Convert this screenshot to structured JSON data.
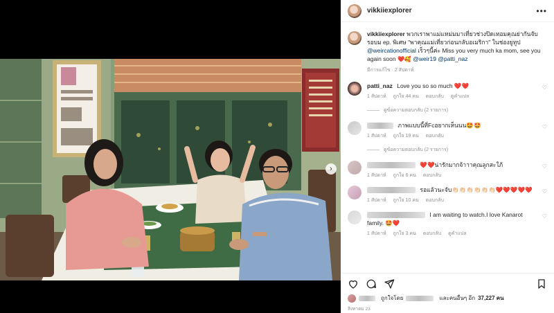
{
  "post": {
    "username": "vikkiiexplorer",
    "caption_user": "vikkiiexplorer",
    "caption_text": "พวกเราพาแม่แหม่มมาเที่ยวช่วงปิดเทอมคุณย่ากันจับรอบม ep. พิเศษ \"พาคุณแม่เที่ยวก่อนกลับอเมริกา\" ในช่องยูทูป",
    "caption_link": "@weircationofficial",
    "caption_text2": "เร็วๆนี้ค่ะ Miss you very much ka mom, see you again soon",
    "caption_emoji": "❤️🥰",
    "caption_mention1": "@weir19",
    "caption_mention2": "@patti_naz",
    "caption_meta": "มีการแก้ไข · 2 สัปดาห์"
  },
  "comments": [
    {
      "user": "patti_naz",
      "text": "Love you so so much ❤️❤️",
      "time": "1 สัปดาห์",
      "likes": "ถูกใจ 44 คน",
      "reply": "ตอบกลับ",
      "translate": "ดูคำแปล",
      "view_replies": "ดูข้อความตอบกลับ (2 รายการ)"
    },
    {
      "user": "",
      "text": "ภาพแบบนี้ที่Fcอยากเห็นนน🤩🤩",
      "time": "1 สัปดาห์",
      "likes": "ถูกใจ 19 คน",
      "reply": "ตอบกลับ",
      "view_replies": "ดูข้อความตอบกลับ (2 รายการ)"
    },
    {
      "user": "",
      "text": "❤️❤️น่ารักมากจ้าาาคุณลูกสะใภ้",
      "time": "1 สัปดาห์",
      "likes": "ถูกใจ 6 คน",
      "reply": "ตอบกลับ"
    },
    {
      "user": "",
      "text": "รอแล้วนะจับ👏🏻👏🏻👏🏻👏🏻👏🏻👏🏻❤️❤️❤️❤️❤️",
      "time": "1 สัปดาห์",
      "likes": "ถูกใจ 10 คน",
      "reply": "ตอบกลับ"
    },
    {
      "user": "",
      "text": "I am waiting to watch.I love Kanarot family. 🤩❤️",
      "time": "1 สัปดาห์",
      "likes": "ถูกใจ 3 คน",
      "reply": "ตอบกลับ",
      "translate": "ดูคำแปล"
    }
  ],
  "footer": {
    "liked_by_prefix": "ถูกใจโดย",
    "liked_by_suffix": "และคนอื่นๆ อีก",
    "likes_count": "37,227 คน",
    "date": "สิงหาคม 23"
  },
  "icons": {
    "more": "more-icon",
    "heart": "heart-icon",
    "comment": "comment-icon",
    "share": "share-icon",
    "bookmark": "bookmark-icon",
    "next": "chevron-right-icon"
  },
  "glyphs": {
    "more": "•••",
    "next": "›",
    "small_heart": "♡"
  }
}
